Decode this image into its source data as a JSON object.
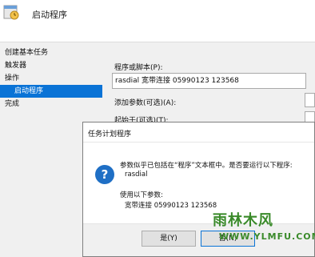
{
  "window": {
    "title": "启动程序"
  },
  "steps": [
    {
      "label": "创建基本任务"
    },
    {
      "label": "触发器"
    },
    {
      "label": "操作"
    },
    {
      "label": "启动程序"
    },
    {
      "label": "完成"
    }
  ],
  "form": {
    "program_label": "程序或脚本(P):",
    "program_value": "rasdial 宽带连接 05990123 123568",
    "args_label": "添加参数(可选)(A):",
    "start_in_label": "起始于(可选)(T):"
  },
  "dialog": {
    "title": "任务计划程序",
    "message_line1": "参数似乎已包括在“程序”文本框中。是否要运行以下程序:",
    "program": "rasdial",
    "params_label": "使用以下参数:",
    "params_value": "宽带连接 05990123 123568",
    "yes_label": "是(Y)",
    "no_label": "否(N)"
  },
  "watermark": {
    "logo_text": "雨林木风",
    "url": "WWW.YLMFU.COM"
  },
  "colors": {
    "accent": "#0a73d6",
    "question_icon": "#1f6fc5",
    "watermark": "#3a8a2a"
  }
}
